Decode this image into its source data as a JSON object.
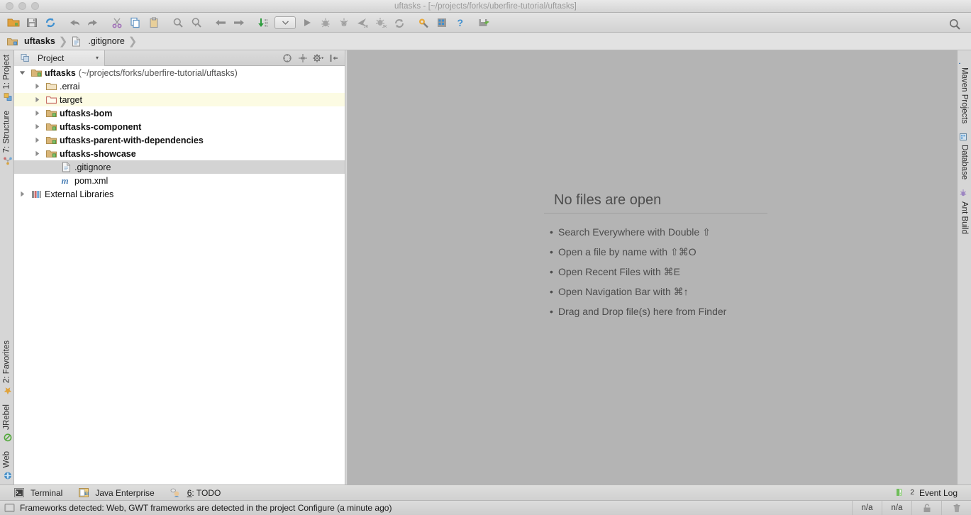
{
  "window": {
    "title": "uftasks - [~/projects/forks/uberfire-tutorial/uftasks]"
  },
  "toolbar": {
    "items": [
      {
        "name": "open-icon",
        "label": "Open"
      },
      {
        "name": "save-all-icon",
        "label": "Save All"
      },
      {
        "name": "sync-icon",
        "label": "Synchronize"
      },
      {
        "name": "undo-icon",
        "label": "Undo"
      },
      {
        "name": "redo-icon",
        "label": "Redo"
      },
      {
        "name": "cut-icon",
        "label": "Cut"
      },
      {
        "name": "copy-icon",
        "label": "Copy"
      },
      {
        "name": "paste-icon",
        "label": "Paste"
      },
      {
        "name": "find-icon",
        "label": "Find"
      },
      {
        "name": "replace-icon",
        "label": "Replace"
      },
      {
        "name": "back-icon",
        "label": "Back"
      },
      {
        "name": "forward-icon",
        "label": "Forward"
      },
      {
        "name": "compile-icon",
        "label": "Compile"
      },
      {
        "name": "run-config-combo",
        "label": "Select Run/Debug Configuration"
      },
      {
        "name": "run-icon",
        "label": "Run"
      },
      {
        "name": "debug-icon",
        "label": "Debug"
      },
      {
        "name": "coverage-icon",
        "label": "Run with Coverage"
      },
      {
        "name": "attach-profiler-icon",
        "label": "Attach Profiler"
      },
      {
        "name": "debug-attach-icon",
        "label": "Attach to Process"
      },
      {
        "name": "update-project-icon",
        "label": "Update Project"
      },
      {
        "name": "settings-icon",
        "label": "Settings"
      },
      {
        "name": "project-structure-icon",
        "label": "Project Structure"
      },
      {
        "name": "help-icon",
        "label": "Help"
      },
      {
        "name": "save-workspace-icon",
        "label": "Save Workspace"
      }
    ],
    "search_icon": "search-icon"
  },
  "breadcrumb": [
    {
      "icon": "module-folder-icon",
      "label": "uftasks",
      "bold": true
    },
    {
      "icon": "file-icon",
      "label": ".gitignore",
      "bold": false
    }
  ],
  "left_stripe": {
    "top": [
      {
        "label": "1: Project",
        "icon": "project-icon"
      },
      {
        "label": "7: Structure",
        "icon": "structure-icon"
      }
    ],
    "bottom": [
      {
        "label": "2: Favorites",
        "icon": "star-icon"
      },
      {
        "label": "JRebel",
        "icon": "jrebel-icon"
      },
      {
        "label": "Web",
        "icon": "web-icon"
      }
    ]
  },
  "right_stripe": {
    "items": [
      {
        "label": "Maven Projects",
        "icon": "maven-icon"
      },
      {
        "label": "Database",
        "icon": "database-icon"
      },
      {
        "label": "Ant Build",
        "icon": "ant-icon"
      }
    ]
  },
  "project_panel": {
    "tab_label": "Project",
    "tab_caret": "▾",
    "tools": [
      {
        "name": "collapse-all-icon",
        "label": "Collapse All"
      },
      {
        "name": "scroll-from-source-icon",
        "label": "Scroll from Source"
      },
      {
        "name": "settings-gear-icon",
        "label": "Options"
      },
      {
        "name": "hide-panel-icon",
        "label": "Hide"
      }
    ],
    "tree": [
      {
        "indent": 0,
        "twisty": "open",
        "icon": "module-folder-icon",
        "name": "uftasks",
        "bold": true,
        "path": "(~/projects/forks/uberfire-tutorial/uftasks)",
        "state": "normal"
      },
      {
        "indent": 1,
        "twisty": "closed",
        "icon": "folder-icon",
        "name": ".errai",
        "bold": false,
        "path": "",
        "state": "normal"
      },
      {
        "indent": 1,
        "twisty": "closed",
        "icon": "excluded-folder-icon",
        "name": "target",
        "bold": false,
        "path": "",
        "state": "excluded"
      },
      {
        "indent": 1,
        "twisty": "closed",
        "icon": "module-folder-icon",
        "name": "uftasks-bom",
        "bold": true,
        "path": "",
        "state": "normal"
      },
      {
        "indent": 1,
        "twisty": "closed",
        "icon": "module-folder-icon",
        "name": "uftasks-component",
        "bold": true,
        "path": "",
        "state": "normal"
      },
      {
        "indent": 1,
        "twisty": "closed",
        "icon": "module-folder-icon",
        "name": "uftasks-parent-with-dependencies",
        "bold": true,
        "path": "",
        "state": "normal"
      },
      {
        "indent": 1,
        "twisty": "closed",
        "icon": "module-folder-icon",
        "name": "uftasks-showcase",
        "bold": true,
        "path": "",
        "state": "normal"
      },
      {
        "indent": 2,
        "twisty": "none",
        "icon": "file-icon",
        "name": ".gitignore",
        "bold": false,
        "path": "",
        "state": "selected"
      },
      {
        "indent": 2,
        "twisty": "none",
        "icon": "maven-pom-icon",
        "name": "pom.xml",
        "bold": false,
        "path": "",
        "state": "normal"
      },
      {
        "indent": 0,
        "twisty": "closed",
        "icon": "libraries-icon",
        "name": "External Libraries",
        "bold": false,
        "path": "",
        "state": "normal"
      }
    ]
  },
  "editor": {
    "empty_title": "No files are open",
    "hints": [
      "Search Everywhere with Double ⇧",
      "Open a file by name with ⇧⌘O",
      "Open Recent Files with ⌘E",
      "Open Navigation Bar with ⌘↑",
      "Drag and Drop file(s) here from Finder"
    ]
  },
  "bottom_bar": {
    "items": [
      {
        "label": "Terminal",
        "icon": "terminal-icon",
        "underline": ""
      },
      {
        "label": "Java Enterprise",
        "icon": "java-enterprise-icon",
        "underline": ""
      },
      {
        "label": ": TODO",
        "icon": "todo-icon",
        "underline": "6"
      }
    ],
    "event_log": {
      "label": "Event Log",
      "count": "2",
      "icon": "event-log-icon"
    }
  },
  "status_bar": {
    "message": "Frameworks detected: Web, GWT frameworks are detected in the project Configure (a minute ago)",
    "icon": "status-hint-icon",
    "cells": [
      "n/a",
      "n/a"
    ],
    "lock_icon": "lock-icon",
    "trash_icon": "trash-icon"
  },
  "colors": {
    "excluded_row_bg": "#fcfbe3",
    "selected_row_bg": "#d3d3d3",
    "editor_bg": "#b4b4b4",
    "accent_blue": "#3d7ab5",
    "folder_tan": "#d6b171",
    "excluded_red": "#c9736a"
  }
}
